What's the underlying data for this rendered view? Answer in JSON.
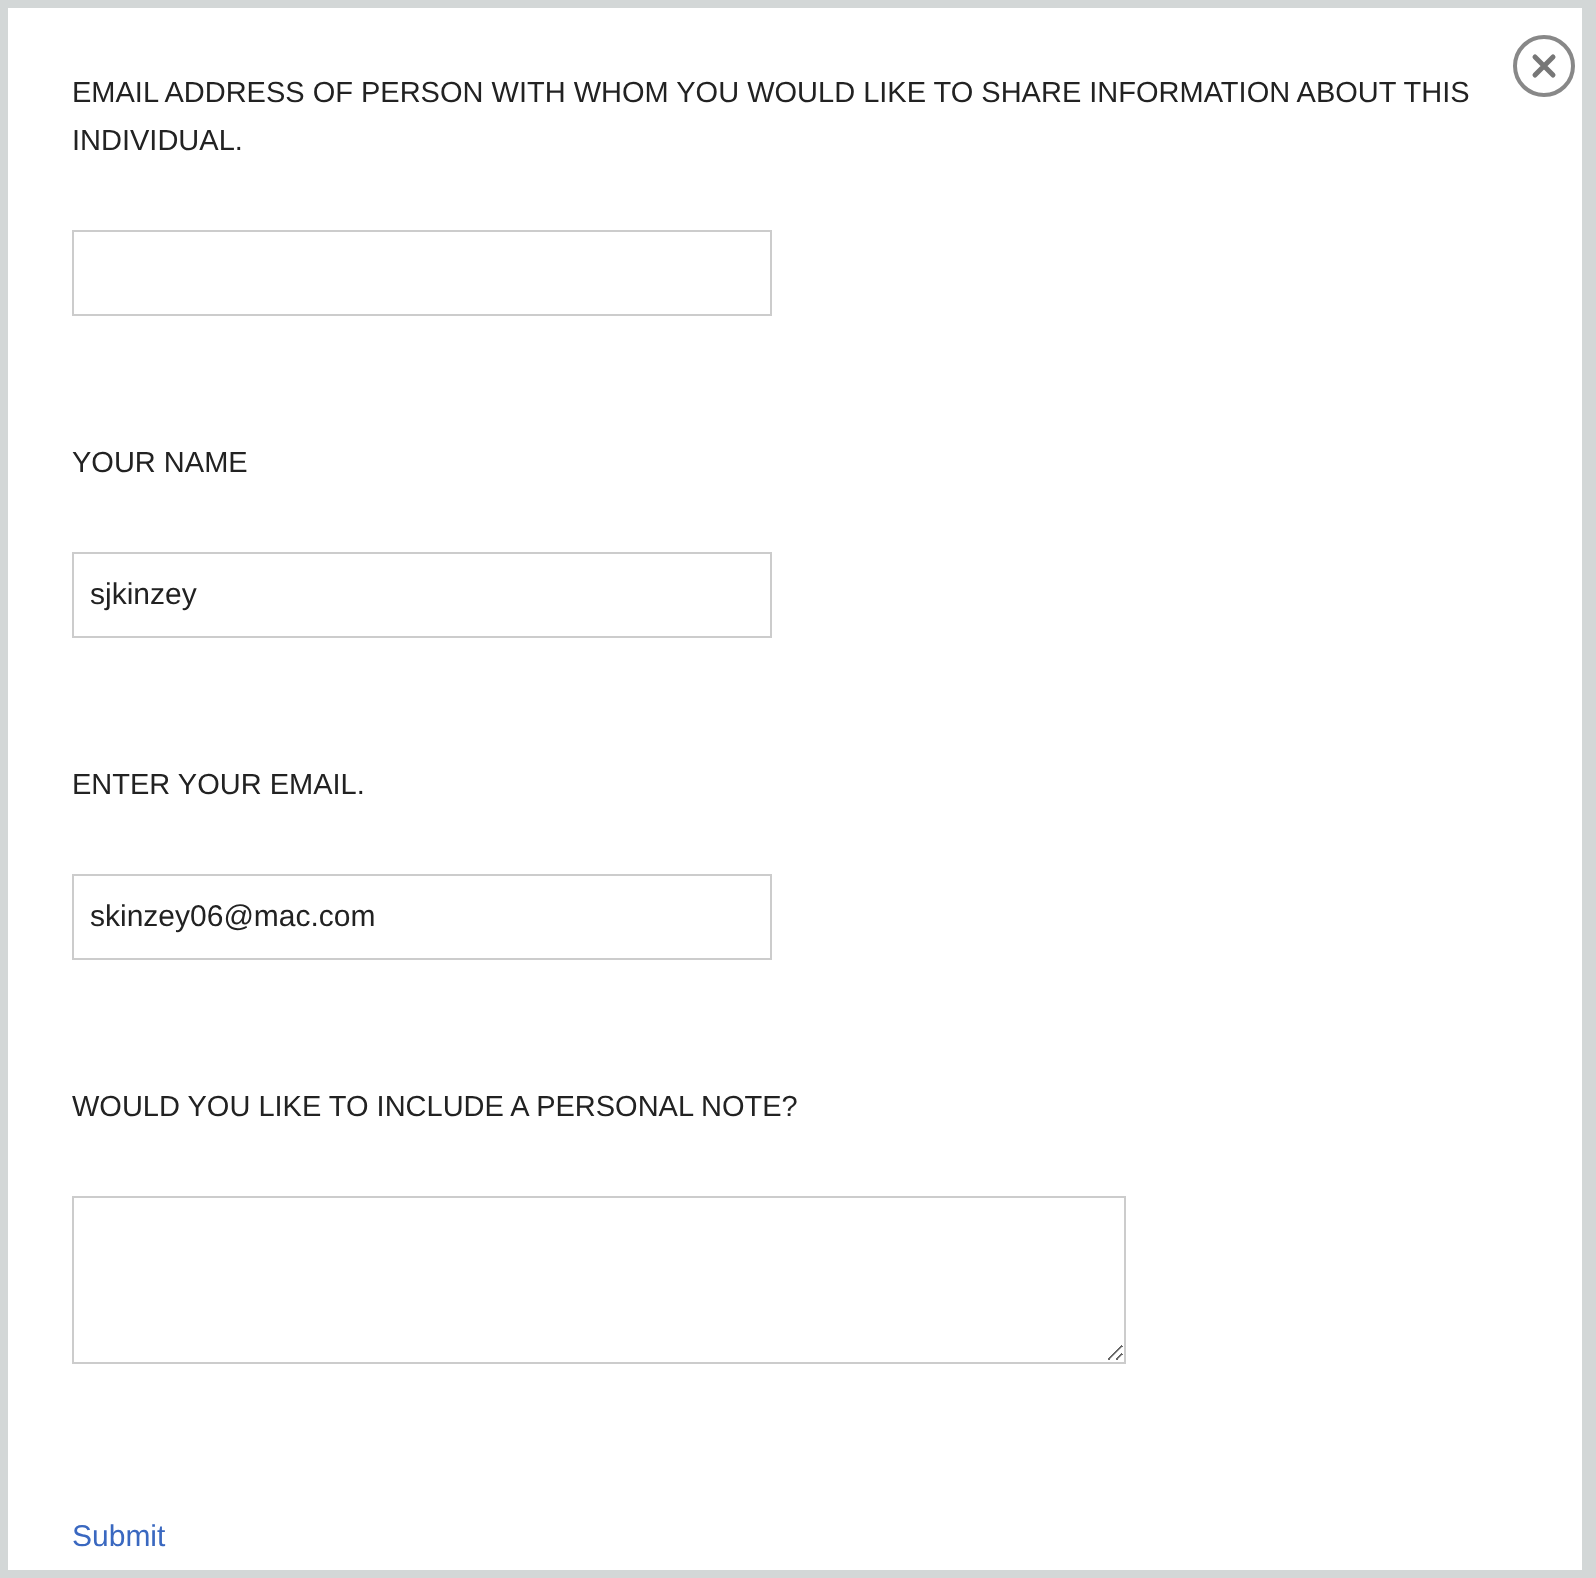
{
  "fields": [
    {
      "kind": "input",
      "label": "EMAIL ADDRESS OF PERSON WITH WHOM YOU WOULD LIKE TO SHARE INFORMATION ABOUT THIS INDIVIDUAL."
    },
    {
      "kind": "input",
      "label": "YOUR NAME",
      "value": "sjkinzey"
    },
    {
      "kind": "input",
      "label": "ENTER YOUR EMAIL.",
      "value": "skinzey06@mac.com"
    },
    {
      "kind": "textarea",
      "label": "WOULD YOU LIKE TO INCLUDE A PERSONAL NOTE?"
    }
  ],
  "submit": "Submit"
}
